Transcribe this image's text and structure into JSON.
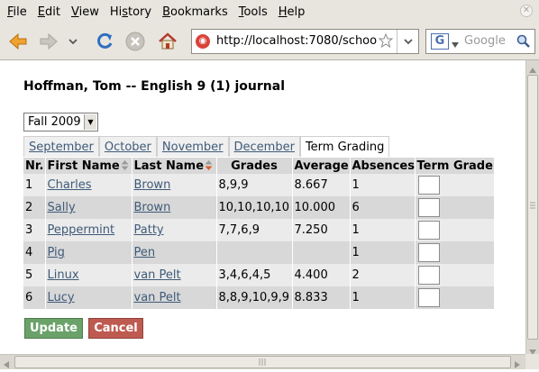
{
  "menu": {
    "items": [
      {
        "mnemonic": "F",
        "rest": "ile"
      },
      {
        "mnemonic": "E",
        "rest": "dit"
      },
      {
        "mnemonic": "V",
        "rest": "iew"
      },
      {
        "mnemonic": "",
        "rest": "Hi",
        "mnemonic2": "s",
        "rest2": "tory"
      },
      {
        "mnemonic": "B",
        "rest": "ookmarks"
      },
      {
        "mnemonic": "T",
        "rest": "ools"
      },
      {
        "mnemonic": "H",
        "rest": "elp"
      }
    ]
  },
  "navbar": {
    "url": "http://localhost:7080/schoo",
    "search_placeholder": "Google"
  },
  "page": {
    "title": "Hoffman, Tom -- English 9 (1) journal",
    "term_selected": "Fall 2009",
    "tabs": [
      "September",
      "October",
      "November",
      "December",
      "Term Grading"
    ],
    "active_tab": "Term Grading"
  },
  "table": {
    "headers": {
      "nr": "Nr.",
      "first_name": "First Name",
      "last_name": "Last Name",
      "grades": "Grades",
      "average": "Average",
      "absences": "Absences",
      "term_grade": "Term Grade"
    },
    "rows": [
      {
        "nr": "1",
        "first": "Charles",
        "last": "Brown",
        "grades": "8,9,9",
        "average": "8.667",
        "absences": "1"
      },
      {
        "nr": "2",
        "first": "Sally",
        "last": "Brown",
        "grades": "10,10,10,10",
        "average": "10.000",
        "absences": "6"
      },
      {
        "nr": "3",
        "first": "Peppermint",
        "last": "Patty",
        "grades": "7,7,6,9",
        "average": "7.250",
        "absences": "1"
      },
      {
        "nr": "4",
        "first": "Pig",
        "last": "Pen",
        "grades": "",
        "average": "",
        "absences": "1"
      },
      {
        "nr": "5",
        "first": "Linux",
        "last": "van Pelt",
        "grades": "3,4,6,4,5",
        "average": "4.400",
        "absences": "2"
      },
      {
        "nr": "6",
        "first": "Lucy",
        "last": "van Pelt",
        "grades": "8,8,9,10,9,9",
        "average": "8.833",
        "absences": "1"
      }
    ]
  },
  "buttons": {
    "update": "Update",
    "cancel": "Cancel"
  },
  "colors": {
    "update_bg": "#6aa26a",
    "cancel_bg": "#bf5a50",
    "link": "#3f5a78"
  }
}
